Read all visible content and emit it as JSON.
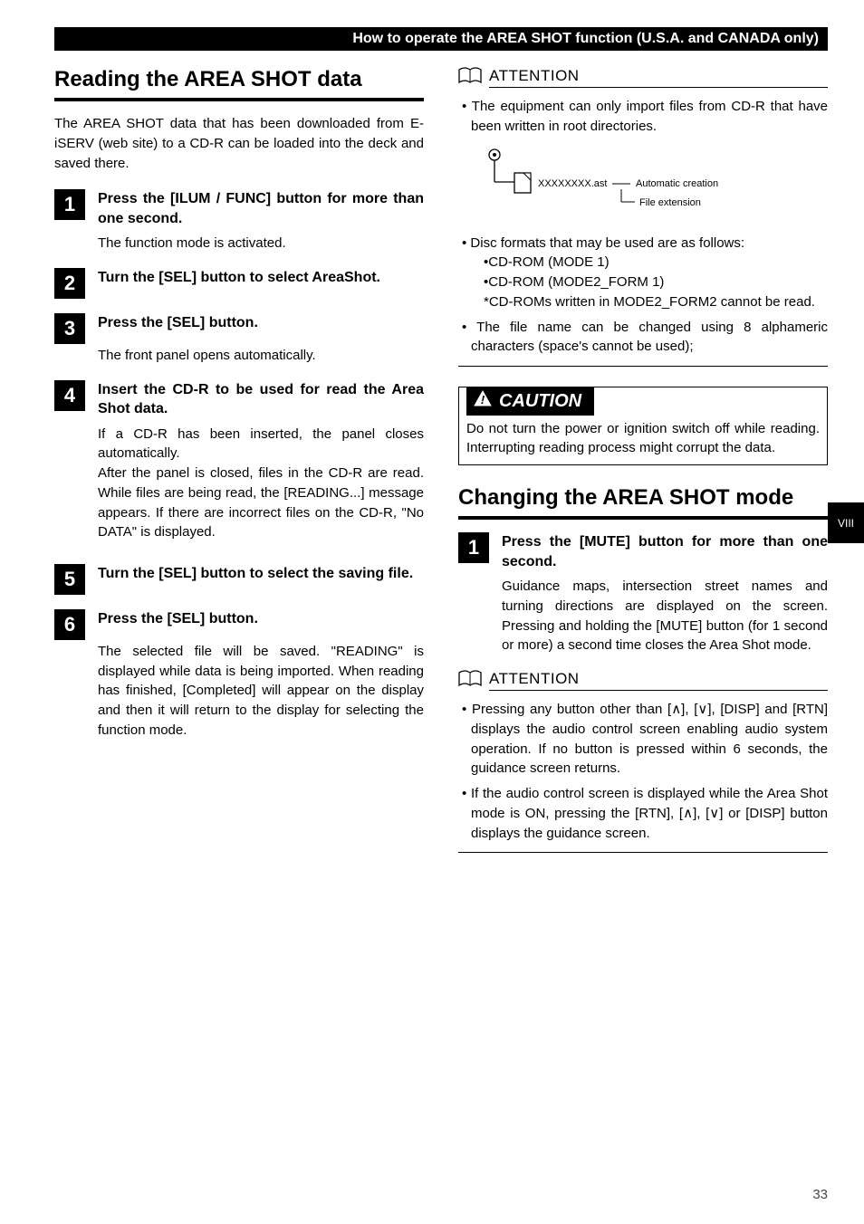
{
  "header": {
    "title": "How to operate the AREA SHOT function (U.S.A. and CANADA only)"
  },
  "side_tab": "VIII",
  "page_number": "33",
  "left": {
    "section_title": "Reading the AREA SHOT data",
    "intro": "The AREA SHOT data that has been downloaded from E-iSERV (web site) to a CD-R can be loaded into the deck and saved there.",
    "steps": [
      {
        "num": "1",
        "head": "Press the [ILUM / FUNC] button for more than one second.",
        "desc": "The function mode is activated."
      },
      {
        "num": "2",
        "head": "Turn the [SEL] button to select AreaShot.",
        "desc": ""
      },
      {
        "num": "3",
        "head": "Press the [SEL] button.",
        "desc": "The front panel opens automatically."
      },
      {
        "num": "4",
        "head": "Insert the CD-R to be used for read the Area Shot data.",
        "desc": "If a CD-R has been inserted, the panel closes automatically.\nAfter the panel is closed, files in the CD-R are read. While files are being read, the [READING...] message appears. If there are incorrect files on the CD-R, \"No DATA\" is displayed."
      },
      {
        "num": "5",
        "head": "Turn the [SEL] button to select the saving file.",
        "desc": ""
      },
      {
        "num": "6",
        "head": "Press the [SEL] button.",
        "desc": "The selected file will be saved. \"READING\" is displayed while data is being imported. When reading has finished, [Completed] will appear on the display and then it will return to the display for selecting the function mode."
      }
    ]
  },
  "right": {
    "attention1_label": "ATTENTION",
    "attention1_items": {
      "i0": "The equipment can only import files from CD-R that have been written in root directories.",
      "i1_lead": "Disc formats that may be used are as follows:",
      "i1_a": "•CD-ROM (MODE 1)",
      "i1_b": "•CD-ROM (MODE2_FORM 1)",
      "i1_c": "*CD-ROMs written in MODE2_FORM2 cannot be read.",
      "i2": "The file name can be changed using 8 alphameric characters (space's cannot be used);"
    },
    "diagram": {
      "filename": "XXXXXXXX.ast",
      "auto": "Automatic creation",
      "ext": "File extension"
    },
    "caution_title": "CAUTION",
    "caution_body": "Do not turn the power or ignition switch off while reading. Interrupting reading process might corrupt the data.",
    "section2_title": "Changing the AREA SHOT mode",
    "steps2": [
      {
        "num": "1",
        "head": "Press the [MUTE] button for more than one second.",
        "desc": "Guidance maps, intersection street names and turning directions are displayed on the screen. Pressing and holding the [MUTE] button (for 1 second or more) a second time closes the Area Shot mode."
      }
    ],
    "attention2_label": "ATTENTION",
    "attention2_items": {
      "i0": "Pressing any button other than [∧], [∨], [DISP] and [RTN] displays the audio control screen enabling audio system operation. If no button is pressed within 6 seconds, the guidance screen returns.",
      "i1": "If the audio control screen is displayed while the Area Shot mode is ON, pressing the [RTN], [∧], [∨] or [DISP] button displays the guidance screen."
    }
  }
}
